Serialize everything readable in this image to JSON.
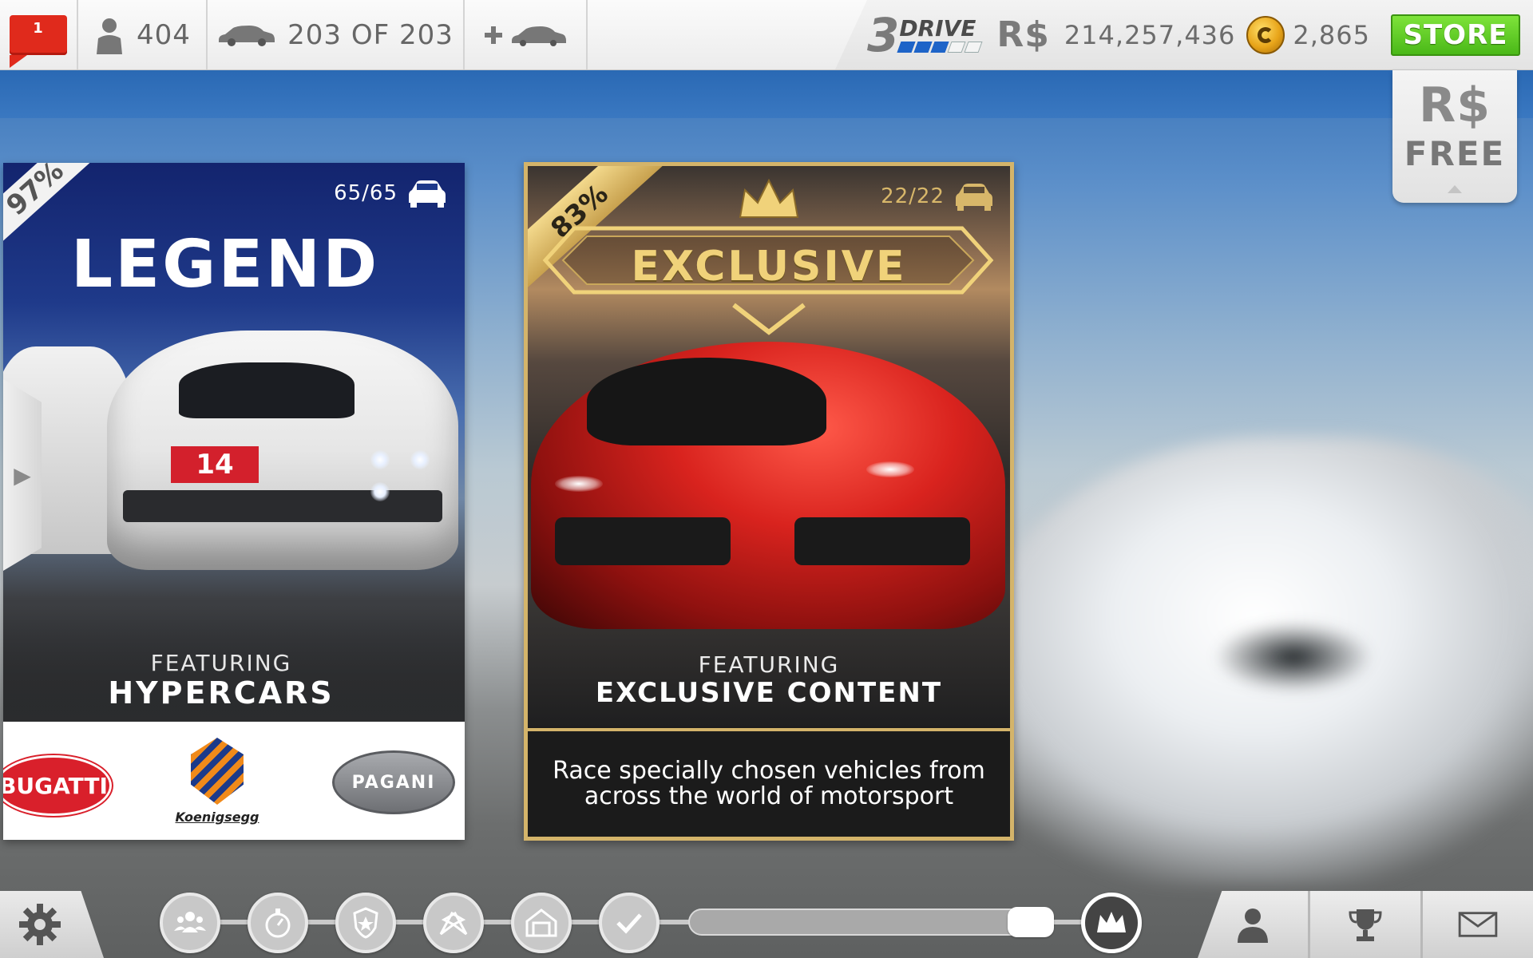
{
  "topbar": {
    "notification_count": "1",
    "driver_level": "404",
    "cars_owned": "203 OF 203",
    "drive_logo_number": "3",
    "drive_logo_word": "DRIVE",
    "rs_label": "R$",
    "rs_balance": "214,257,436",
    "gold_balance": "2,865",
    "store_label": "STORE"
  },
  "free_tab": {
    "currency": "R$",
    "label": "FREE"
  },
  "legend_card": {
    "completion": "97%",
    "car_count": "65/65",
    "title": "LEGEND",
    "featuring_label": "FEATURING",
    "featuring_value": "HYPERCARS",
    "car_number": "14",
    "brands": [
      "BUGATTI",
      "Koenigsegg",
      "PAGANI"
    ]
  },
  "exclusive_card": {
    "completion": "83%",
    "car_count": "22/22",
    "title": "EXCLUSIVE",
    "featuring_label": "FEATURING",
    "featuring_value": "EXCLUSIVE CONTENT",
    "description": "Race specially chosen vehicles from across the world of motorsport"
  },
  "bottom_nav": {
    "tiers": [
      "community",
      "time-trial",
      "shield",
      "race-flags",
      "garage",
      "check",
      "crown"
    ]
  },
  "colors": {
    "store_green": "#4ab818",
    "notification_red": "#e02a1c",
    "gold_accent": "#d4b46a",
    "rs_blue_bar": "#1e64c8"
  }
}
